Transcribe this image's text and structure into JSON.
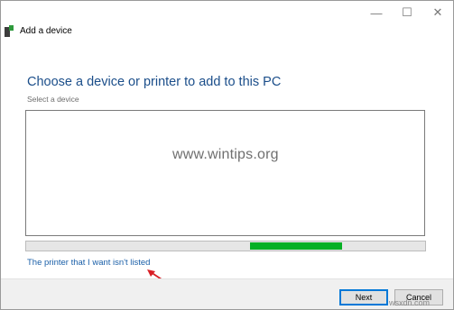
{
  "window": {
    "controls": {
      "minimize": "—",
      "maximize": "☐",
      "close": "✕"
    }
  },
  "header": {
    "title": "Add a device",
    "icon": "device-icon"
  },
  "main": {
    "heading": "Choose a device or printer to add to this PC",
    "sublabel": "Select a device",
    "watermark": "www.wintips.org",
    "progress": {
      "indeterminate": true,
      "fill_start": 0.56,
      "fill_end": 0.79,
      "color": "#06b025"
    },
    "link": "The printer that I want isn't listed"
  },
  "footer": {
    "next_label": "Next",
    "cancel_label": "Cancel"
  },
  "corner_watermark": "wsxdn.com",
  "colors": {
    "heading": "#1b4e8a",
    "link": "#1a5fa8",
    "arrow": "#d81f26"
  }
}
